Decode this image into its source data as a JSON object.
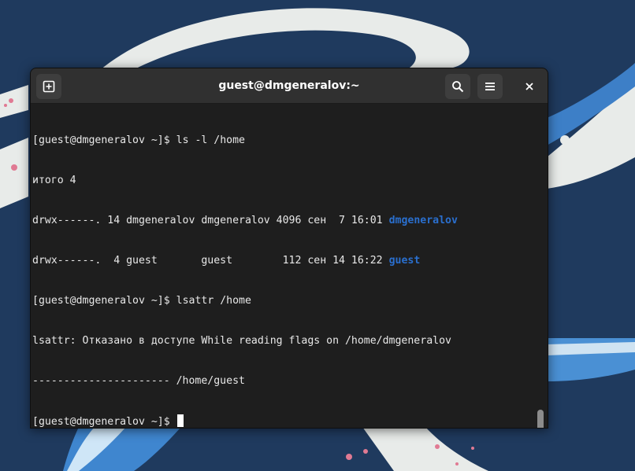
{
  "window": {
    "title": "guest@dmgeneralov:~"
  },
  "icons": {
    "new_tab": "new-tab-icon",
    "search": "search-icon",
    "menu": "hamburger-menu-icon",
    "close": "close-icon"
  },
  "colors": {
    "desktop_background": "#1f3a5e",
    "terminal_background": "#1e1e1e",
    "headerbar": "#303030",
    "directory_text": "#2a6fce",
    "terminal_text": "#e8e8e8"
  },
  "terminal": {
    "lines": [
      {
        "prompt": "[guest@dmgeneralov ~]$ ",
        "command": "ls -l /home"
      },
      {
        "text": "итого 4"
      },
      {
        "text": "drwx------. 14 dmgeneralov dmgeneralov 4096 сен  7 16:01 ",
        "dir": "dmgeneralov"
      },
      {
        "text": "drwx------.  4 guest       guest        112 сен 14 16:22 ",
        "dir": "guest"
      },
      {
        "prompt": "[guest@dmgeneralov ~]$ ",
        "command": "lsattr /home"
      },
      {
        "text": "lsattr: Отказано в доступе While reading flags on /home/dmgeneralov"
      },
      {
        "text": "---------------------- /home/guest"
      },
      {
        "prompt": "[guest@dmgeneralov ~]$ ",
        "command": ""
      }
    ]
  }
}
